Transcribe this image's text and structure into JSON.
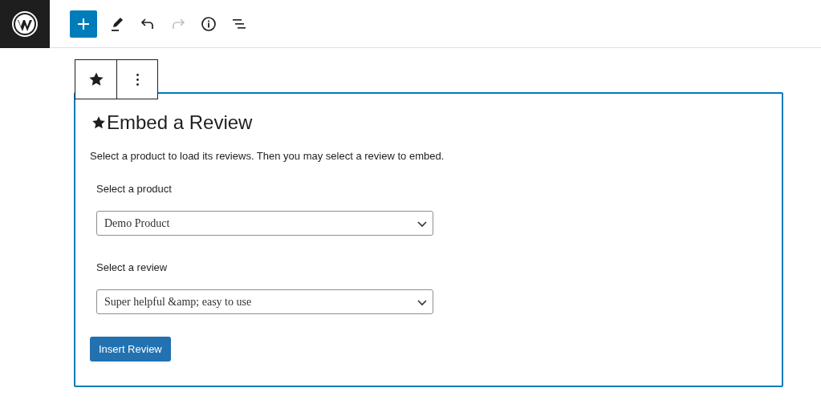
{
  "header_toolbar": [
    {
      "kind": "add",
      "selected": true,
      "disabled": false
    },
    {
      "kind": "edit",
      "selected": false,
      "disabled": false
    },
    {
      "kind": "undo",
      "selected": false,
      "disabled": false
    },
    {
      "kind": "redo",
      "selected": false,
      "disabled": true
    },
    {
      "kind": "info",
      "selected": false,
      "disabled": false
    },
    {
      "kind": "outline",
      "selected": false,
      "disabled": false
    }
  ],
  "block_toolbar": [
    {
      "kind": "star"
    },
    {
      "kind": "more"
    }
  ],
  "block": {
    "title": "Embed a Review",
    "description": "Select a product to load its reviews. Then you may select a review to embed.",
    "fields": [
      {
        "label": "Select a product",
        "value": "Demo Product"
      },
      {
        "label": "Select a review",
        "value": "Super helpful &amp; easy to use"
      }
    ],
    "button": "Insert Review"
  }
}
